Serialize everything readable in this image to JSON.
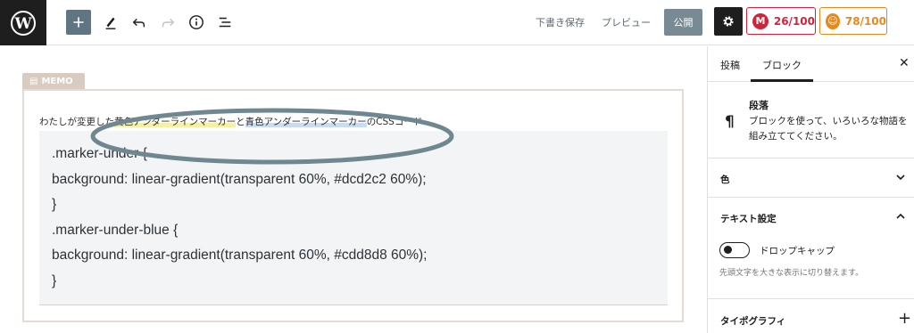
{
  "toolbar": {
    "save_draft": "下書き保存",
    "preview": "プレビュー",
    "publish": "公開",
    "seo_score": "26/100",
    "readability_score": "78/100",
    "icons": [
      "wordpress-logo-icon",
      "plus-icon",
      "pencil-icon",
      "undo-icon",
      "redo-icon",
      "info-icon",
      "list-view-icon",
      "gear-icon"
    ]
  },
  "editor": {
    "memo_label": "MEMO",
    "text_before": "わたしが変更した",
    "mark_yellow": "黄色アンダーラインマーカー",
    "text_middle": "と",
    "mark_blue": "青色アンダーラインマーカー",
    "text_after": "のCSSコード",
    "code_lines": [
      ".marker-under {",
      "background: linear-gradient(transparent 60%, #dcd2c2 60%);",
      "}",
      ".marker-under-blue {",
      "background: linear-gradient(transparent 60%, #cdd8d8 60%);",
      "}"
    ]
  },
  "sidebar": {
    "tab_post": "投稿",
    "tab_block": "ブロック",
    "block_name": "段落",
    "block_description": "ブロックを使って、いろいろな物語を組み立ててください。",
    "panel_color": "色",
    "panel_text_settings": "テキスト設定",
    "drop_cap_label": "ドロップキャップ",
    "drop_cap_help": "先頭文字を大きな表示に切り替えます。",
    "panel_typography": "タイポグラフィ"
  },
  "colors": {
    "accent": "#5f7682",
    "seo_red": "#d0243c",
    "readability_orange": "#e58a1f",
    "memo": "#d8cbbf",
    "annotation_ellipse": "#6f8790"
  }
}
